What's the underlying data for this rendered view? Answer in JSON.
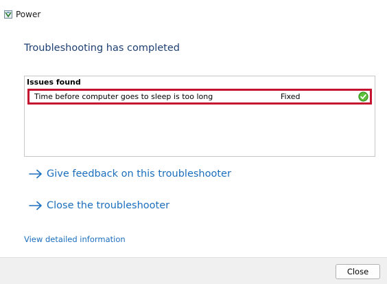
{
  "window": {
    "title": "Power",
    "app_icon": "power-troubleshooter-icon"
  },
  "main": {
    "heading": "Troubleshooting has completed",
    "issues": {
      "header": "Issues found",
      "rows": [
        {
          "name": "Time before computer goes to sleep is too long",
          "status": "Fixed",
          "status_icon": "check-circle-icon"
        }
      ]
    },
    "links": [
      {
        "label": "Give feedback on this troubleshooter",
        "icon": "arrow-right-icon"
      },
      {
        "label": "Close the troubleshooter",
        "icon": "arrow-right-icon"
      }
    ],
    "detail_link": "View detailed information"
  },
  "footer": {
    "close_label": "Close"
  },
  "colors": {
    "heading": "#1e3f73",
    "link": "#1a6ebd",
    "highlight_border": "#c4122f",
    "success": "#4caf2e"
  }
}
